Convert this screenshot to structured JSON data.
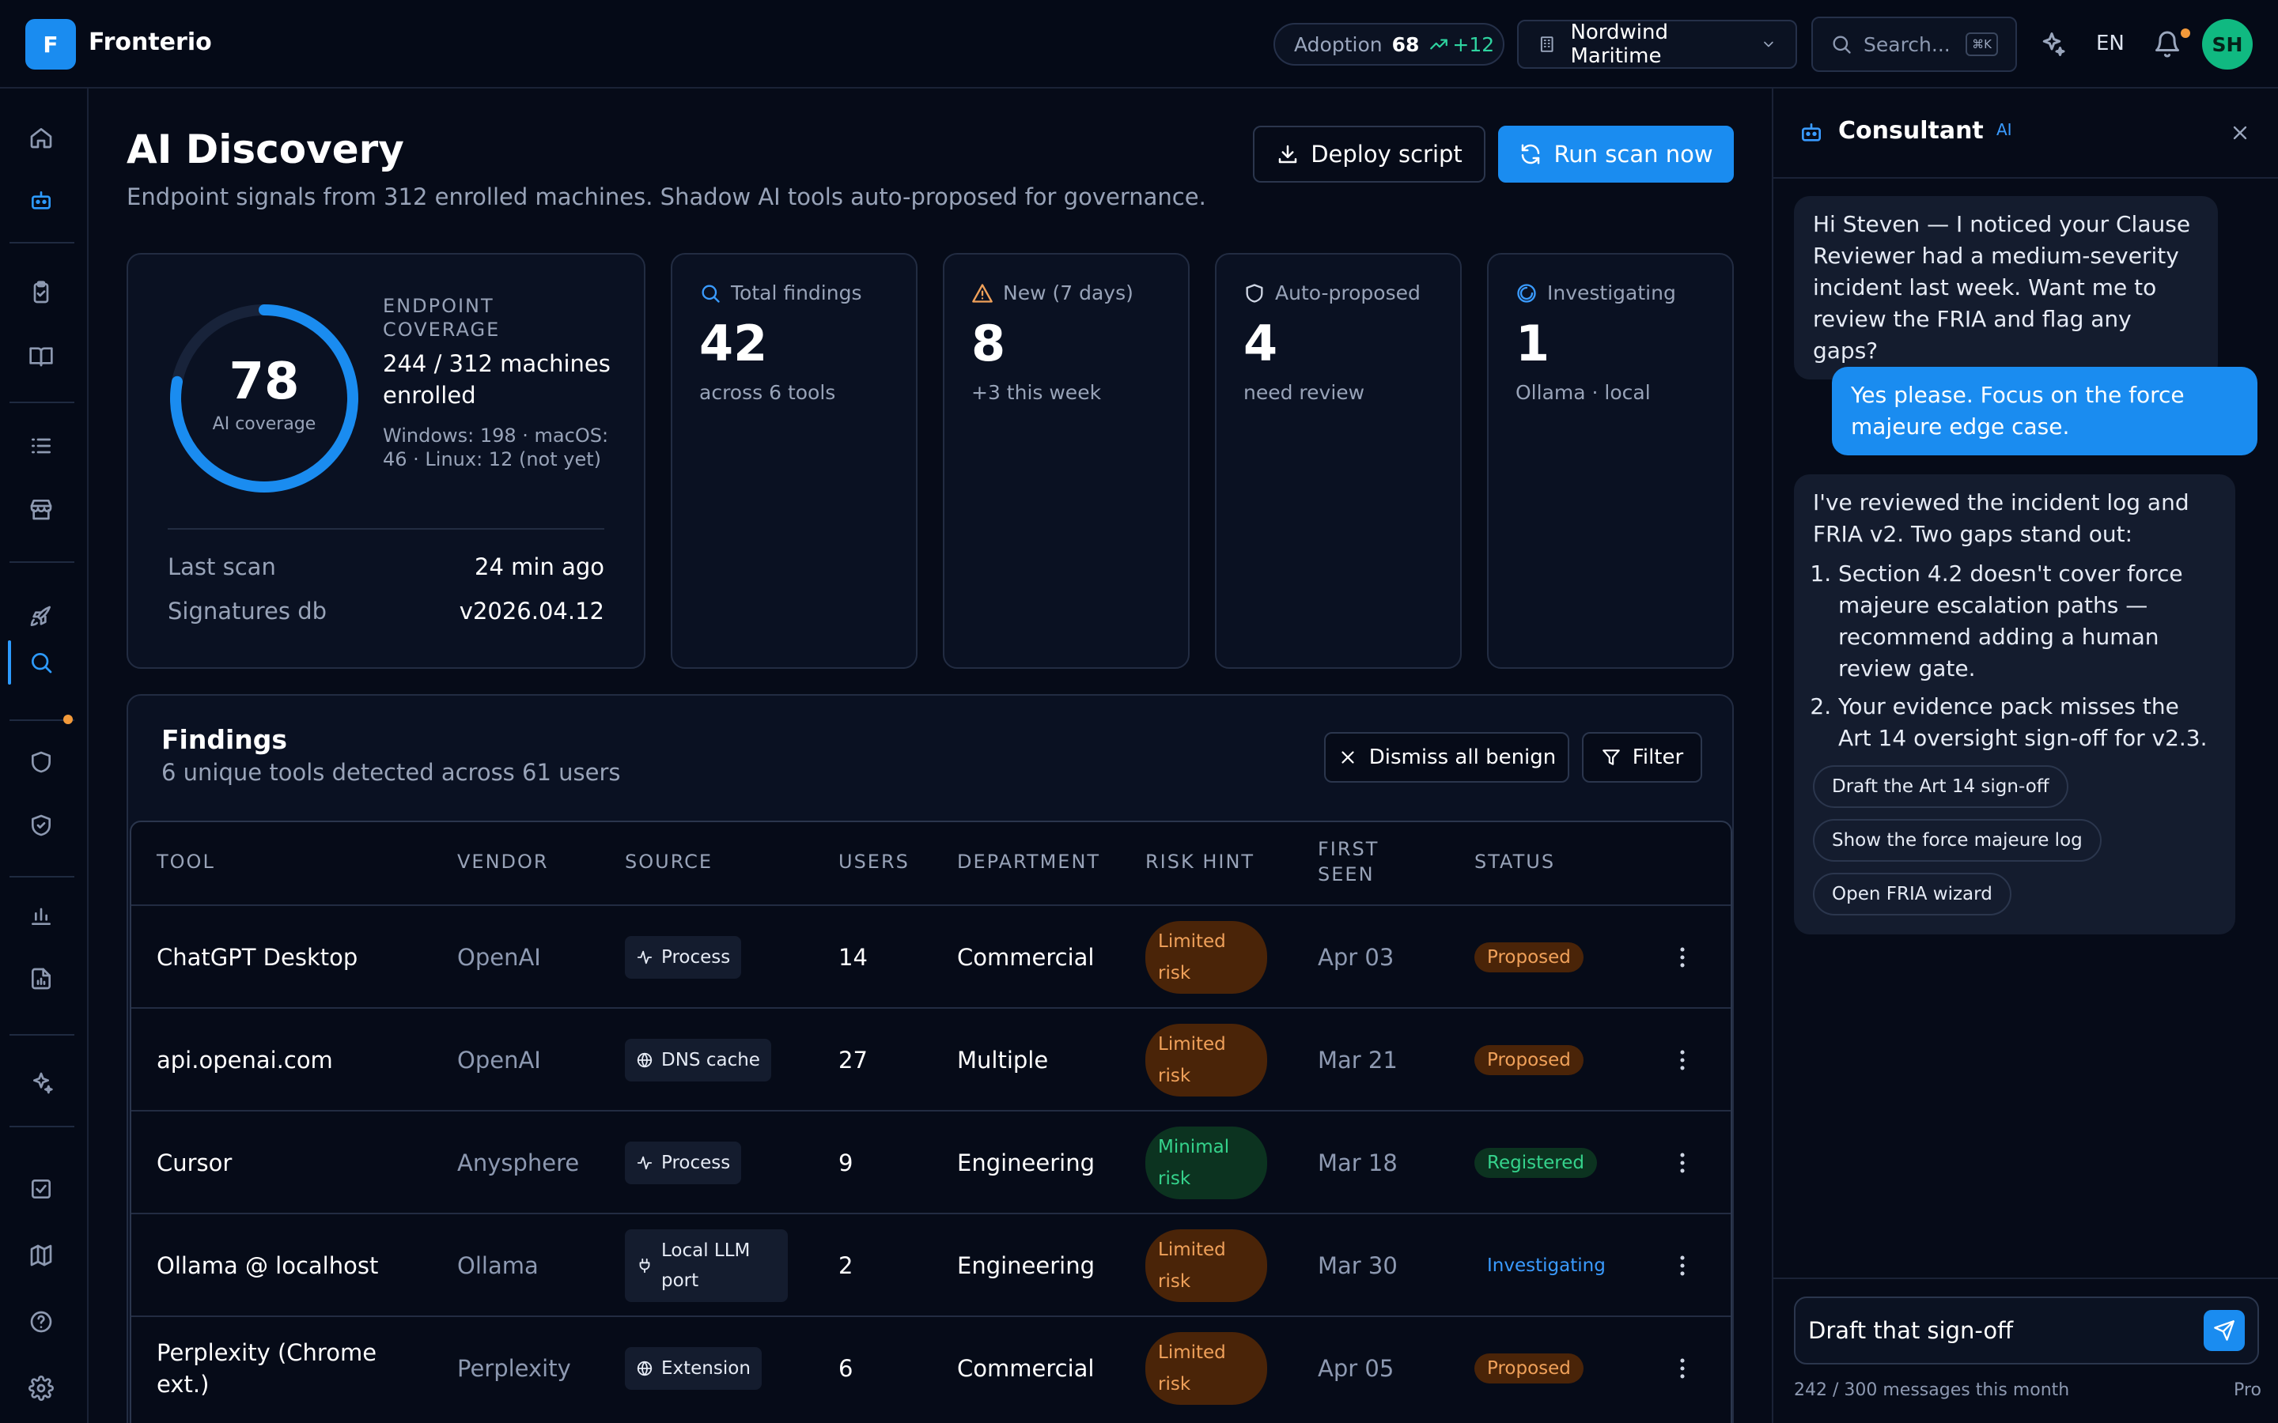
{
  "app": {
    "logo_letter": "F",
    "name": "Fronterio"
  },
  "topbar": {
    "adoption_label": "Adoption",
    "adoption_value": "68",
    "adoption_delta": "+12",
    "org_name": "Nordwind Maritime",
    "search_placeholder": "Search...",
    "search_shortcut": "⌘K",
    "language": "EN",
    "has_notification": true,
    "avatar_initials": "SH"
  },
  "rail": {
    "items": [
      "home-icon",
      "bot-icon",
      "clipboard-icon",
      "book-icon",
      "list-icon",
      "store-icon",
      "rocket-icon",
      "search-icon",
      "shield-icon",
      "shield-check-icon",
      "bar-chart-icon",
      "report-icon",
      "sparkles-icon",
      "checkbox-icon",
      "map-icon",
      "help-icon",
      "settings-icon"
    ],
    "active": "search-icon"
  },
  "page": {
    "title": "AI Discovery",
    "subtitle": "Endpoint signals from 312 enrolled machines. Shadow AI tools auto-proposed for governance.",
    "deploy_label": "Deploy script",
    "scan_label": "Run scan now"
  },
  "coverage": {
    "value": "78",
    "percent": 78,
    "caption": "AI coverage",
    "heading": "ENDPOINT COVERAGE",
    "enrolled": "244 / 312 machines enrolled",
    "os_breakdown": "Windows: 198 · macOS: 46 · Linux: 12 (not yet)",
    "last_scan_label": "Last scan",
    "last_scan_value": "24 min ago",
    "signatures_label": "Signatures db",
    "signatures_value": "v2026.04.12"
  },
  "stats": [
    {
      "label": "Total findings",
      "value": "42",
      "sub": "across 6 tools",
      "icon": "search-icon"
    },
    {
      "label": "New (7 days)",
      "value": "8",
      "sub": "+3 this week",
      "icon": "warning-icon"
    },
    {
      "label": "Auto-proposed",
      "value": "4",
      "sub": "need review",
      "icon": "shield-icon"
    },
    {
      "label": "Investigating",
      "value": "1",
      "sub": "Ollama · local",
      "icon": "spinner-icon"
    }
  ],
  "findings": {
    "title": "Findings",
    "subtitle": "6 unique tools detected across 61 users",
    "dismiss_label": "Dismiss all benign",
    "filter_label": "Filter",
    "columns": [
      "TOOL",
      "VENDOR",
      "SOURCE",
      "USERS",
      "DEPARTMENT",
      "RISK HINT",
      "FIRST SEEN",
      "STATUS"
    ],
    "rows": [
      {
        "tool": "ChatGPT Desktop",
        "vendor": "OpenAI",
        "source": "Process",
        "source_icon": "activity-icon",
        "users": "14",
        "department": "Commercial",
        "risk": "Limited risk",
        "risk_level": "limited",
        "first_seen": "Apr 03",
        "status": "Proposed",
        "status_kind": "proposed"
      },
      {
        "tool": "api.openai.com",
        "vendor": "OpenAI",
        "source": "DNS cache",
        "source_icon": "globe-icon",
        "users": "27",
        "department": "Multiple",
        "risk": "Limited risk",
        "risk_level": "limited",
        "first_seen": "Mar 21",
        "status": "Proposed",
        "status_kind": "proposed"
      },
      {
        "tool": "Cursor",
        "vendor": "Anysphere",
        "source": "Process",
        "source_icon": "activity-icon",
        "users": "9",
        "department": "Engineering",
        "risk": "Minimal risk",
        "risk_level": "minimal",
        "first_seen": "Mar 18",
        "status": "Registered",
        "status_kind": "registered"
      },
      {
        "tool": "Ollama @ localhost",
        "vendor": "Ollama",
        "source": "Local LLM port",
        "source_icon": "plug-icon",
        "users": "2",
        "department": "Engineering",
        "risk": "Limited risk",
        "risk_level": "limited",
        "first_seen": "Mar 30",
        "status": "Investigating",
        "status_kind": "investigating"
      },
      {
        "tool": "Perplexity (Chrome ext.)",
        "vendor": "Perplexity",
        "source": "Extension",
        "source_icon": "globe-icon",
        "users": "6",
        "department": "Commercial",
        "risk": "Limited risk",
        "risk_level": "limited",
        "first_seen": "Apr 05",
        "status": "Proposed",
        "status_kind": "proposed"
      }
    ]
  },
  "consultant": {
    "title": "Consultant",
    "badge": "AI",
    "messages": [
      {
        "role": "assistant",
        "text": "Hi Steven — I noticed your Clause Reviewer had a medium-severity incident last week. Want me to review the FRIA and flag any gaps?"
      },
      {
        "role": "user",
        "text": "Yes please. Focus on the force majeure edge case."
      },
      {
        "role": "assistant",
        "text": "I've reviewed the incident log and FRIA v2. Two gaps stand out:",
        "list": [
          "Section 4.2 doesn't cover force majeure escalation paths — recommend adding a human review gate.",
          "Your evidence pack misses the Art 14 oversight sign-off for v2.3."
        ],
        "suggestions": [
          "Draft the Art 14 sign-off",
          "Show the force majeure log",
          "Open FRIA wizard"
        ]
      }
    ],
    "input_value": "Draft that sign-off",
    "quota": "242 / 300 messages this month",
    "plan": "Pro"
  },
  "colors": {
    "accent": "#1a8cf0",
    "warning": "#f0a15a",
    "success": "#35d38c",
    "background": "#060b18"
  }
}
